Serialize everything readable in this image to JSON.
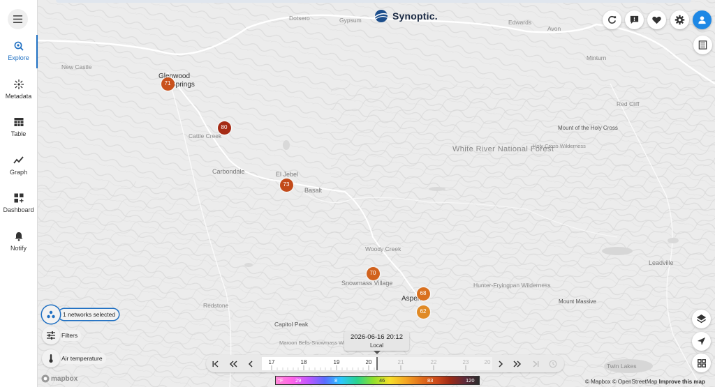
{
  "sidebar": {
    "items": [
      {
        "label": "Explore",
        "icon": "explore-icon"
      },
      {
        "label": "Metadata",
        "icon": "metadata-icon"
      },
      {
        "label": "Table",
        "icon": "table-icon"
      },
      {
        "label": "Graph",
        "icon": "graph-icon"
      },
      {
        "label": "Dashboard",
        "icon": "dashboard-icon"
      },
      {
        "label": "Notify",
        "icon": "bell-icon"
      }
    ],
    "active": "Explore"
  },
  "logo": {
    "text": "Synoptic."
  },
  "places": {
    "dotsero": "Dotsero",
    "gypsum": "Gypsum",
    "edwards": "Edwards",
    "avon": "Avon",
    "minturn": "Minturn",
    "new_castle": "New Castle",
    "glenwood_1": "Glenwood",
    "glenwood_2": "Springs",
    "red_cliff": "Red Cliff",
    "mount_holy_cross": "Mount of the Holy Cross",
    "holy_cross_wilderness": "Holy Cross Wilderness",
    "white_river": "White River National Forest",
    "cattle_creek": "Cattle Creek",
    "carbondale": "Carbondale",
    "el_jebel": "El Jebel",
    "basalt": "Basalt",
    "woody_creek": "Woody Creek",
    "snowmass": "Snowmass Village",
    "hunter_fryingpan": "Hunter-Fryingpan Wilderness",
    "leadville": "Leadville",
    "aspen": "Aspen",
    "redstone": "Redstone",
    "mount_massive": "Mount Massive",
    "capitol_peak": "Capitol Peak",
    "maroon_bells": "Maroon Bells-Snowmass Wilderness",
    "twin_lakes": "Twin Lakes"
  },
  "markers": [
    {
      "value": "71",
      "color": "#c9511c"
    },
    {
      "value": "80",
      "color": "#a52a14"
    },
    {
      "value": "73",
      "color": "#c24a1a"
    },
    {
      "value": "70",
      "color": "#d1621e"
    },
    {
      "value": "68",
      "color": "#d9701f"
    },
    {
      "value": "62",
      "color": "#e08a26"
    }
  ],
  "controls": {
    "networks": "1 networks selected",
    "filters": "Filters",
    "variable": "Air temperature"
  },
  "time": {
    "datetime": "2026-06-16 20:12",
    "zone": "Local",
    "ticks": [
      "17",
      "18",
      "19",
      "20",
      "21",
      "22",
      "23",
      "20"
    ],
    "current_hour": "20"
  },
  "legend": {
    "unit": "°F",
    "labels": [
      "29",
      "8",
      "46",
      "83",
      "120"
    ]
  },
  "attribution": {
    "mapbox": "© Mapbox",
    "osm": "© OpenStreetMap",
    "improve": "Improve this map",
    "logo": "mapbox"
  },
  "colors": {
    "accent": "#1e6fc2"
  }
}
